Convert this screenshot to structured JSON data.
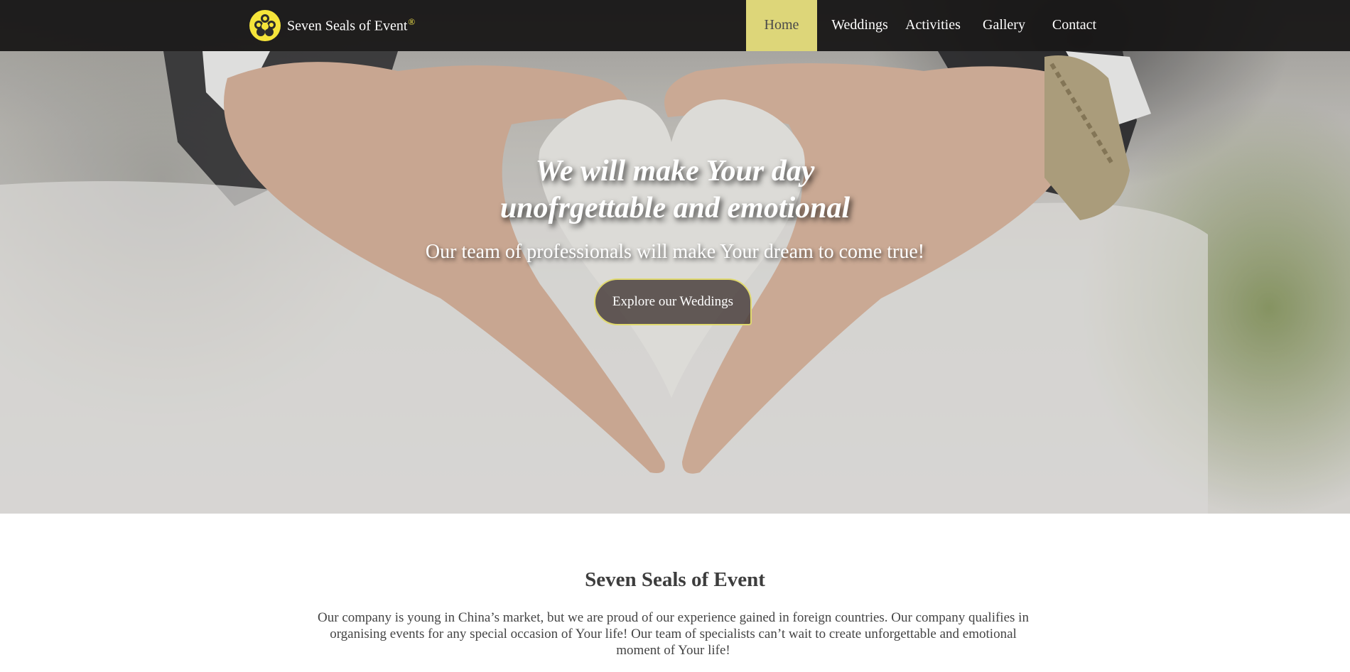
{
  "brand": {
    "name": "Seven Seals of Event",
    "mark": "®",
    "logo_icon": "flower-seal-icon",
    "accent_color": "#ddd679"
  },
  "nav": {
    "items": [
      {
        "label": "Home",
        "active": true
      },
      {
        "label": "Weddings",
        "active": false
      },
      {
        "label": "Activities",
        "active": false
      },
      {
        "label": "Gallery",
        "active": false
      },
      {
        "label": "Contact",
        "active": false
      }
    ]
  },
  "hero": {
    "title_line1": "We will make Your day",
    "title_line2": "unofrgettable and emotional",
    "subtitle": "Our team of professionals will make Your dream to come true!",
    "cta_label": "Explore our Weddings",
    "image": "hands-heart-wedding-photo"
  },
  "about": {
    "title": "Seven Seals of Event",
    "text": "Our company is young in China’s market, but we are proud of our experience gained in foreign countries. Our company qualifies in organising events for any special occasion of Your life! Our team of specialists can’t wait to create unforgettable and emotional moment of Your life!"
  }
}
